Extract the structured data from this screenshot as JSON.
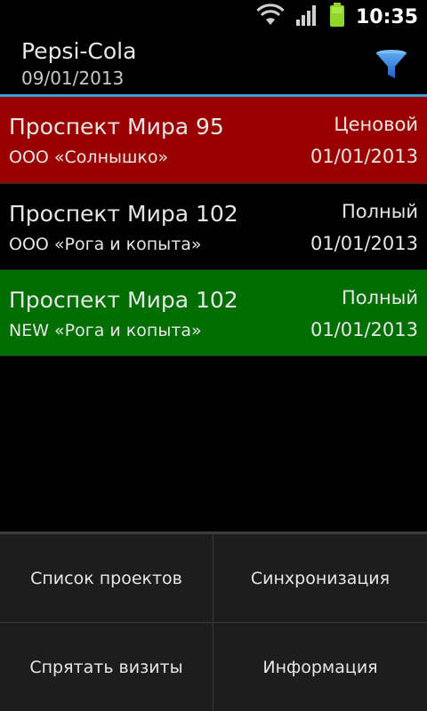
{
  "status_bar": {
    "time": "10:35",
    "icons": [
      "wifi-icon",
      "signal-icon",
      "battery-icon"
    ]
  },
  "header": {
    "title": "Pepsi-Cola",
    "subtitle": "09/01/2013",
    "filter_icon": "filter-icon"
  },
  "visits": [
    {
      "address": "Проспект Мира 95",
      "company": "ООО «Солнышко»",
      "type": "Ценовой",
      "date": "01/01/2013",
      "color": "#9a0000"
    },
    {
      "address": "Проспект Мира 102",
      "company": "ООО «Рога и копыта»",
      "type": "Полный",
      "date": "01/01/2013",
      "color": "#000000"
    },
    {
      "address": "Проспект Мира 102",
      "company": "NEW «Рога и копыта»",
      "type": "Полный",
      "date": "01/01/2013",
      "color": "#006e00"
    }
  ],
  "menu": {
    "projects_list": "Список проектов",
    "sync": "Синхронизация",
    "hide_visits": "Спрятать визиты",
    "info": "Информация"
  },
  "colors": {
    "accent": "#39a0d6",
    "filter": "#1e6fd8",
    "battery": "#8fd62a"
  }
}
